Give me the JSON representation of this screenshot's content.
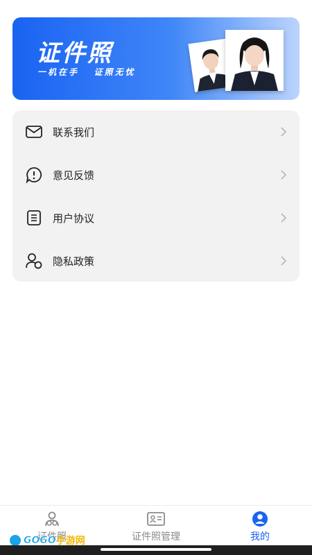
{
  "banner": {
    "title": "证件照",
    "subtitle": "一机在手   证照无忧"
  },
  "menu": {
    "items": [
      {
        "label": "联系我们",
        "icon": "mail-icon"
      },
      {
        "label": "意见反馈",
        "icon": "feedback-icon"
      },
      {
        "label": "用户协议",
        "icon": "document-icon"
      },
      {
        "label": "隐私政策",
        "icon": "privacy-icon"
      }
    ]
  },
  "tabbar": {
    "tabs": [
      {
        "label": "证件照",
        "icon": "id-photo-icon",
        "active": false
      },
      {
        "label": "证件照管理",
        "icon": "id-card-icon",
        "active": false
      },
      {
        "label": "我的",
        "icon": "profile-icon",
        "active": true
      }
    ]
  },
  "watermark": {
    "brand": "GOGO",
    "suffix": "手游网"
  },
  "colors": {
    "accent": "#1a63f2",
    "card_bg": "#f2f2f2",
    "inactive_tab": "#8a8a8a"
  }
}
